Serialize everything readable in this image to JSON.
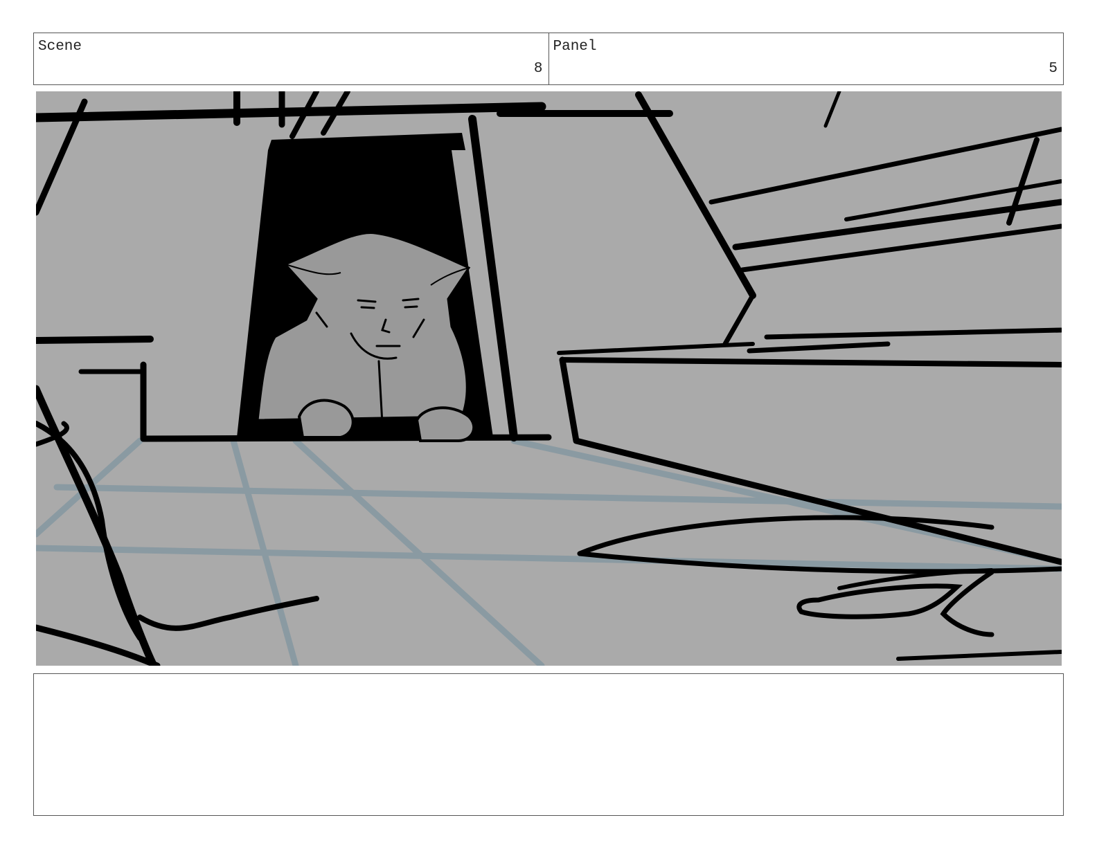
{
  "header": {
    "scene_label": "Scene",
    "scene_number": "8",
    "panel_label": "Panel",
    "panel_number": "5"
  },
  "notes": {
    "text": ""
  },
  "colors": {
    "panel_background": "#aaaaaa",
    "ink": "#000000",
    "floor_lines": "#8a9aa2",
    "character_fill": "#999999"
  }
}
